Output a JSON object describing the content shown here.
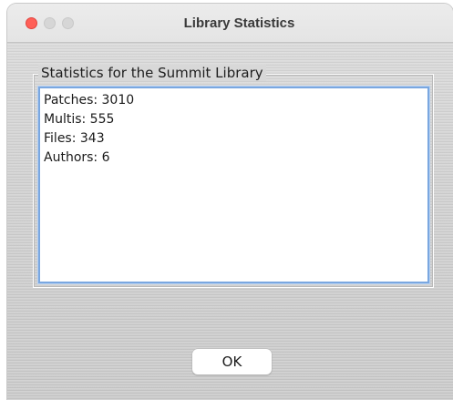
{
  "window": {
    "title": "Library Statistics"
  },
  "group": {
    "title": "Statistics for the Summit Library"
  },
  "stats": [
    "Patches: 3010",
    "Multis: 555",
    "Files: 343",
    "Authors: 6"
  ],
  "buttons": {
    "ok_label": "OK"
  },
  "colors": {
    "close": "#ff5f57",
    "focus_ring": "#7aa7e0"
  }
}
